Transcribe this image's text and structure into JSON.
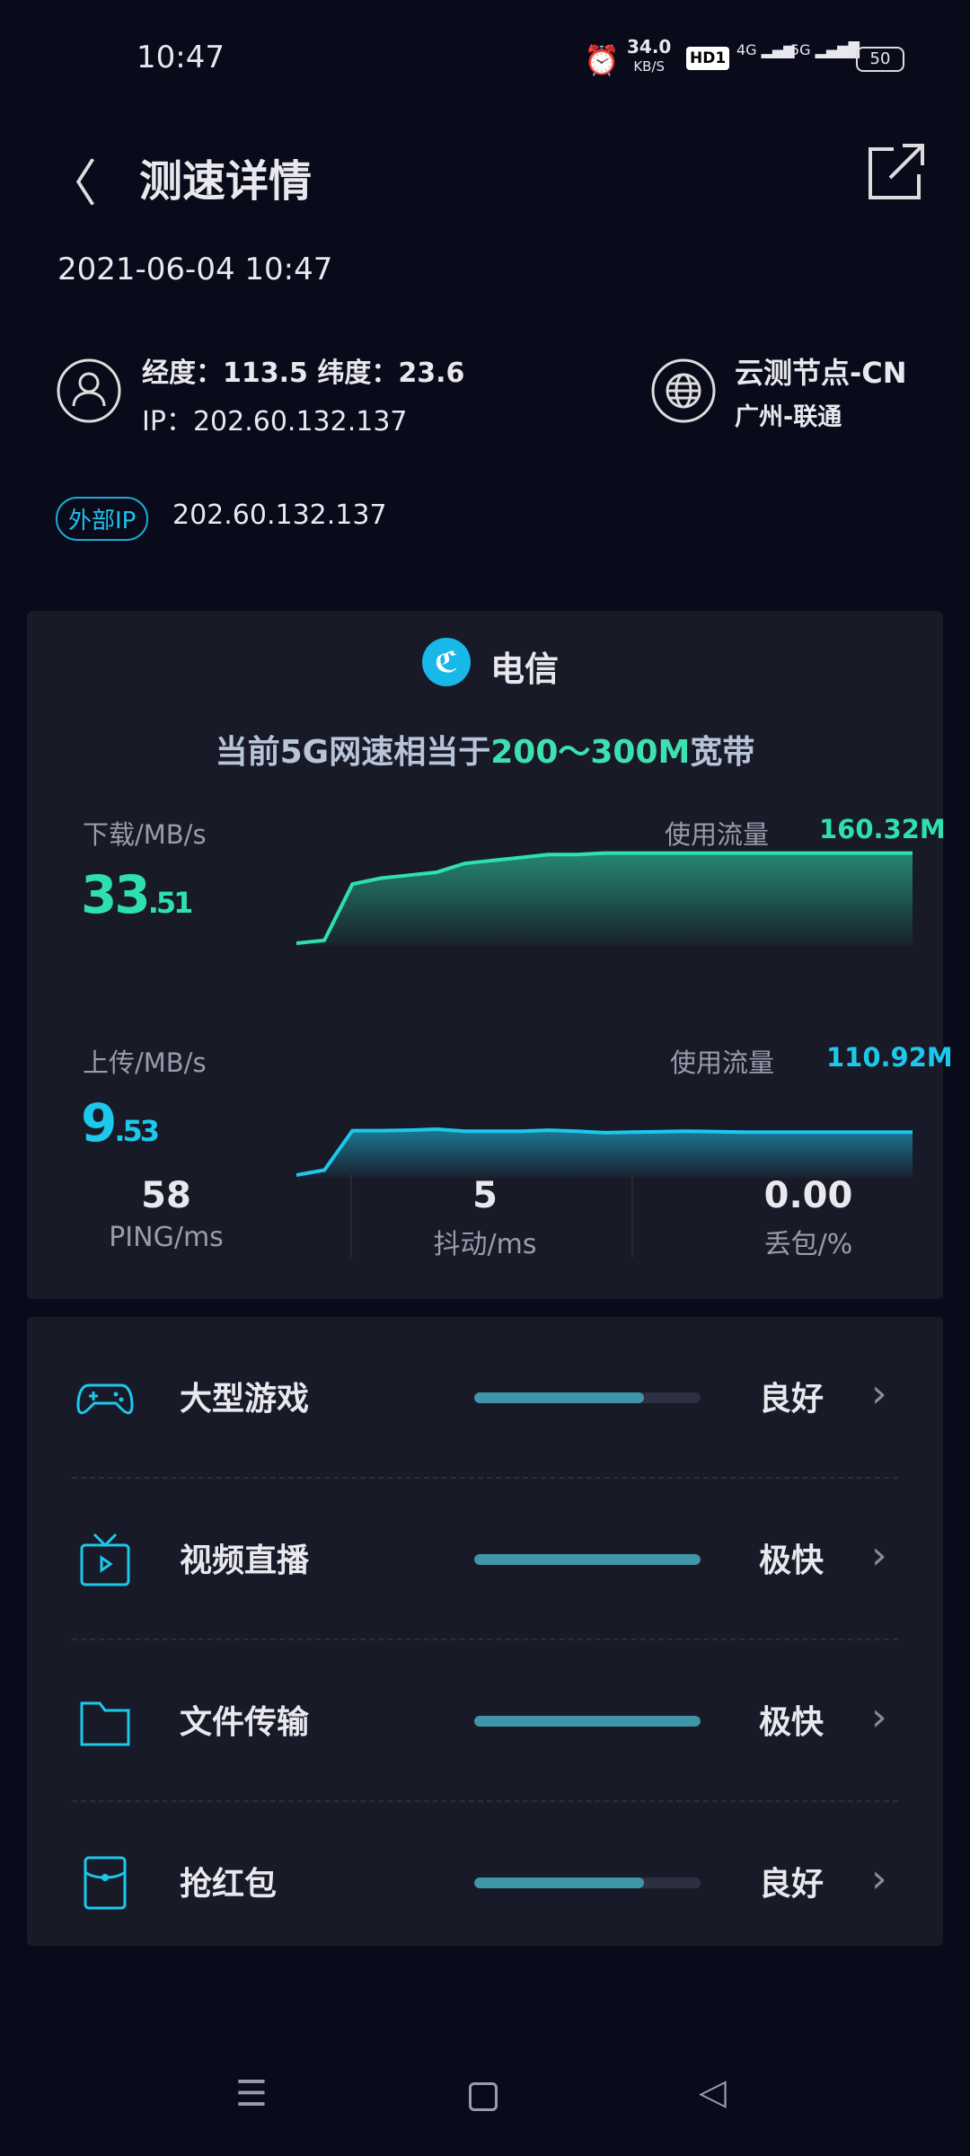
{
  "status_bar": {
    "time": "10:47",
    "net_speed": "34.0",
    "net_unit": "KB/S",
    "hd": "HD1",
    "sig1": "4G",
    "sig2": "5G",
    "battery": "50"
  },
  "header": {
    "title": "测速详情"
  },
  "date": "2021-06-04 10:47",
  "user": {
    "coords": "经度：113.5 纬度：23.6",
    "ip": "IP：202.60.132.137"
  },
  "node": {
    "name": "云测节点-CN",
    "location": "广州-联通"
  },
  "external_ip": {
    "badge": "外部IP",
    "value": "202.60.132.137"
  },
  "carrier": {
    "name": "电信",
    "color": "#18b8e8"
  },
  "summary": {
    "prefix": "当前5G网速相当于",
    "highlight": "200～300M",
    "suffix": "宽带"
  },
  "download": {
    "label": "下载/MB/s",
    "int": "33",
    "dec": ".51",
    "usage_label": "使用流量",
    "usage": "160.32M",
    "color": "#2ee0b0",
    "samples": [
      0,
      1,
      20,
      22,
      23,
      24,
      27,
      28,
      29,
      30,
      30,
      30.5,
      30.5,
      30.5,
      30.5,
      30.5,
      30.5,
      30.5,
      30.5,
      30.5,
      30.5,
      30.5,
      30.5
    ]
  },
  "upload": {
    "label": "上传/MB/s",
    "int": "9",
    "dec": ".53",
    "usage_label": "使用流量",
    "usage": "110.92M",
    "color": "#1cc8ec",
    "samples": [
      0,
      1,
      9,
      9,
      9.1,
      9.3,
      8.9,
      8.9,
      8.9,
      9.1,
      8.9,
      8.6,
      8.7,
      8.8,
      8.9,
      8.8,
      8.7,
      8.7,
      8.7,
      8.7,
      8.7,
      8.7,
      8.7
    ]
  },
  "stats": [
    {
      "value": "58",
      "label": "PING/ms"
    },
    {
      "value": "5",
      "label": "抖动/ms"
    },
    {
      "value": "0.00",
      "label": "丢包/%"
    }
  ],
  "scenarios": [
    {
      "icon": "gamepad-icon",
      "label": "大型游戏",
      "level": 0.75,
      "status": "良好"
    },
    {
      "icon": "tv-icon",
      "label": "视频直播",
      "level": 1.0,
      "status": "极快"
    },
    {
      "icon": "folder-icon",
      "label": "文件传输",
      "level": 1.0,
      "status": "极快"
    },
    {
      "icon": "red-envelope-icon",
      "label": "抢红包",
      "level": 0.75,
      "status": "良好"
    }
  ]
}
